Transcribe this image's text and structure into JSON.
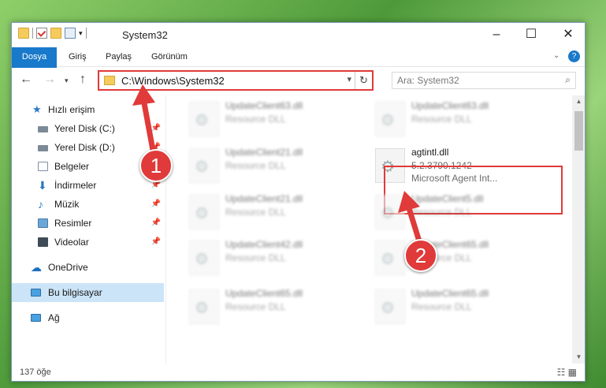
{
  "window": {
    "title": "System32"
  },
  "ribbon": {
    "tabs": [
      "Dosya",
      "Giriş",
      "Paylaş",
      "Görünüm"
    ]
  },
  "address": {
    "path": "C:\\Windows\\System32"
  },
  "search": {
    "placeholder": "Ara: System32"
  },
  "sidebar": {
    "items": [
      {
        "label": "Hızlı erişim",
        "icon": "star-icon"
      },
      {
        "label": "Yerel Disk (C:)",
        "icon": "drive-icon"
      },
      {
        "label": "Yerel Disk (D:)",
        "icon": "drive-icon"
      },
      {
        "label": "Belgeler",
        "icon": "document-icon"
      },
      {
        "label": "İndirmeler",
        "icon": "download-icon"
      },
      {
        "label": "Müzik",
        "icon": "music-icon"
      },
      {
        "label": "Resimler",
        "icon": "pictures-icon"
      },
      {
        "label": "Videolar",
        "icon": "video-icon"
      },
      {
        "label": "OneDrive",
        "icon": "cloud-icon"
      },
      {
        "label": "Bu bilgisayar",
        "icon": "computer-icon"
      },
      {
        "label": "Ağ",
        "icon": "network-icon"
      }
    ]
  },
  "files": [
    {
      "name": "UpdateClient63.dll",
      "sub": "Resource DLL"
    },
    {
      "name": "UpdateClient63.dll",
      "sub": "Resource DLL"
    },
    {
      "name": "UpdateClient21.dll",
      "sub": "Resource DLL"
    },
    {
      "name": "UpdateClient21.dll",
      "sub": "Resource DLL"
    },
    {
      "name": "UpdateClient5.dll",
      "sub": "Resource DLL"
    },
    {
      "name": "UpdateClient42.dll",
      "sub": "Resource DLL"
    },
    {
      "name": "UpdateClient65.dll",
      "sub": "Resource DLL"
    },
    {
      "name": "UpdateClient65.dll",
      "sub": "Resource DLL"
    },
    {
      "name": "UpdateClient65.dll",
      "sub": "Resource DLL"
    }
  ],
  "highlighted_file": {
    "name": "agtintl.dll",
    "version": "5.2.3790.1242",
    "description": "Microsoft Agent Int..."
  },
  "status": {
    "count": "137 öğe"
  },
  "badges": [
    "1",
    "2"
  ],
  "colors": {
    "accent": "#1979ca",
    "highlight": "#e03a3a"
  }
}
